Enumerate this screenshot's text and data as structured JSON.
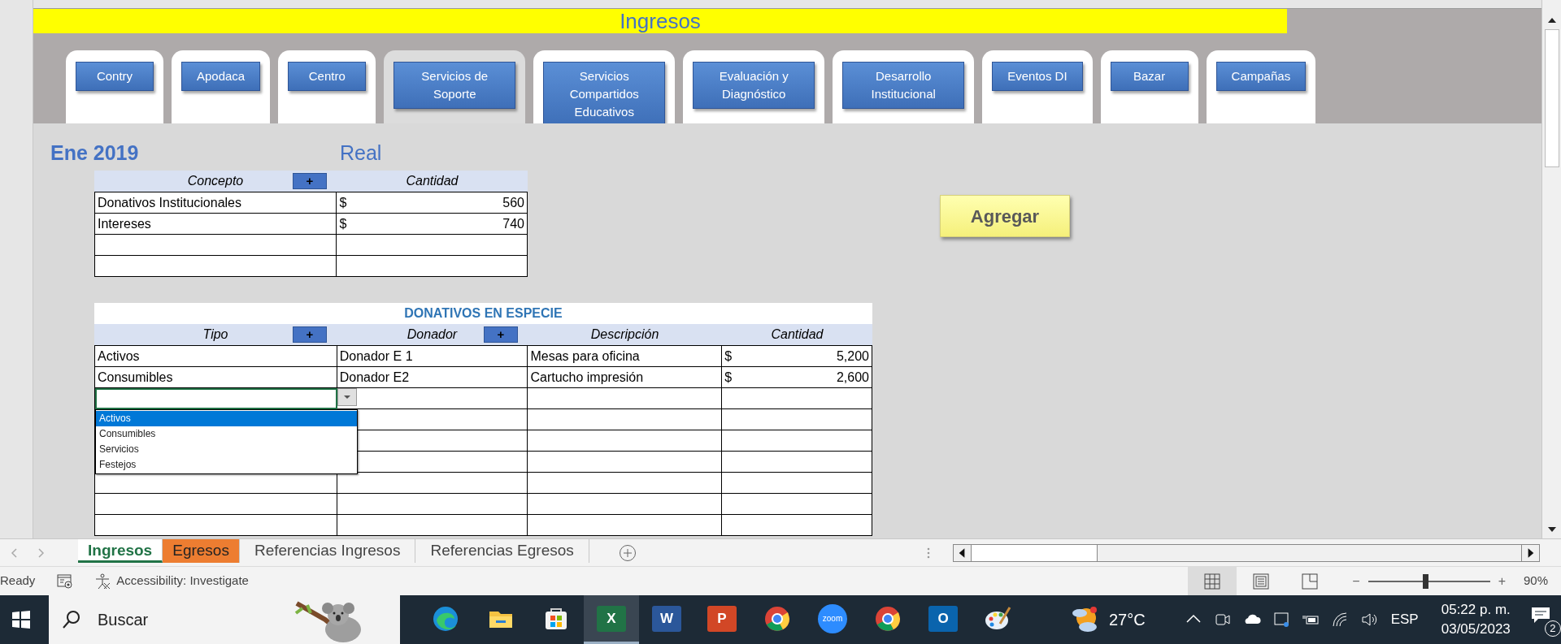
{
  "title": "Ingresos",
  "nav_buttons": [
    {
      "label": "Contry",
      "selected": false
    },
    {
      "label": "Apodaca",
      "selected": false
    },
    {
      "label": "Centro",
      "selected": false
    },
    {
      "label": "Servicios de Soporte",
      "selected": true
    },
    {
      "label": "Servicios Compartidos Educativos",
      "selected": false
    },
    {
      "label": "Evaluación y Diagnóstico",
      "selected": false
    },
    {
      "label": "Desarrollo Institucional",
      "selected": false
    },
    {
      "label": "Eventos DI",
      "selected": false
    },
    {
      "label": "Bazar",
      "selected": false
    },
    {
      "label": "Campañas",
      "selected": false
    }
  ],
  "period": "Ene 2019",
  "mode": "Real",
  "concept_table": {
    "columns": [
      {
        "label": "Concepto",
        "add": "+"
      },
      {
        "label": "Cantidad"
      }
    ],
    "rows": [
      {
        "concepto": "Donativos Institucionales",
        "currency": "$",
        "amount": "560"
      },
      {
        "concepto": "Intereses",
        "currency": "$",
        "amount": "740"
      }
    ]
  },
  "add_button": "Agregar",
  "especie_table": {
    "title": "DONATIVOS EN ESPECIE",
    "columns": [
      {
        "label": "Tipo",
        "add": "+"
      },
      {
        "label": "Donador",
        "add": "+"
      },
      {
        "label": "Descripción"
      },
      {
        "label": "Cantidad"
      }
    ],
    "rows": [
      {
        "tipo": "Activos",
        "donador": "Donador E 1",
        "descripcion": "Mesas para oficina",
        "currency": "$",
        "amount": "5,200"
      },
      {
        "tipo": "Consumibles",
        "donador": "Donador E2",
        "descripcion": "Cartucho impresión",
        "currency": "$",
        "amount": "2,600"
      }
    ],
    "dropdown": {
      "expanded": true,
      "options": [
        {
          "label": "Activos",
          "selected": true
        },
        {
          "label": "Consumibles",
          "selected": false
        },
        {
          "label": "Servicios",
          "selected": false
        },
        {
          "label": "Festejos",
          "selected": false
        }
      ]
    }
  },
  "sheet_tabs": [
    {
      "label": "Ingresos",
      "selected": true,
      "color": "#217346"
    },
    {
      "label": "Egresos",
      "selected": false,
      "color": "#ed7d31"
    },
    {
      "label": "Referencias Ingresos",
      "selected": false
    },
    {
      "label": "Referencias Egresos",
      "selected": false
    }
  ],
  "status_bar": {
    "ready": "Ready",
    "accessibility": "Accessibility: Investigate",
    "views": [
      {
        "kind": "normal",
        "selected": true
      },
      {
        "kind": "layout",
        "selected": false
      },
      {
        "kind": "pagebreak",
        "selected": false
      }
    ],
    "zoom_minus": "−",
    "zoom_plus": "+",
    "zoom": {
      "level": 0.47
    },
    "zoom_text": "90%"
  },
  "taskbar": {
    "search_placeholder": "Buscar",
    "apps": [
      {
        "kind": "edge",
        "active": false
      },
      {
        "kind": "explorer",
        "active": false
      },
      {
        "kind": "store",
        "active": false
      },
      {
        "kind": "excel",
        "active": true
      },
      {
        "kind": "word",
        "active": false
      },
      {
        "kind": "powerpoint",
        "active": false
      },
      {
        "kind": "chrome",
        "active": false
      },
      {
        "kind": "zoom",
        "active": false
      },
      {
        "kind": "chrome",
        "active": false
      },
      {
        "kind": "outlook",
        "active": false
      },
      {
        "kind": "paint",
        "active": false
      }
    ],
    "excel_letter": "X",
    "word_letter": "W",
    "powerpoint_letter": "P",
    "zoom_label": "zoom",
    "outlook_letter": "O",
    "temperature": "27°C",
    "language": "ESP",
    "time": "05:22 p. m.",
    "date": "03/05/2023",
    "notifications": "2"
  }
}
